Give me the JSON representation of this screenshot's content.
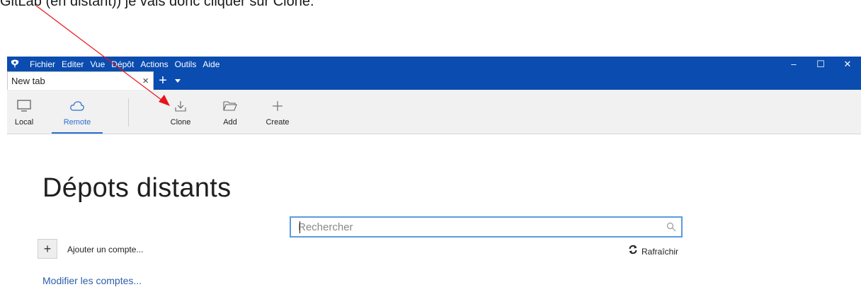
{
  "caption": "GitLab (en distant)) je vais donc cliquer sur Clone.",
  "menu": [
    "Fichier",
    "Editer",
    "Vue",
    "Dépôt",
    "Actions",
    "Outils",
    "Aide"
  ],
  "window_controls": {
    "minimize": "–",
    "maximize": "☐",
    "close": "✕"
  },
  "tab": {
    "label": "New tab",
    "close": "×",
    "add": "+"
  },
  "toolbar": {
    "local": "Local",
    "remote": "Remote",
    "clone": "Clone",
    "add": "Add",
    "create": "Create"
  },
  "main": {
    "title": "Dépots distants",
    "search_placeholder": "Rechercher",
    "add_button": "+",
    "add_account": "Ajouter un compte...",
    "refresh": "Rafraîchir",
    "modify_accounts": "Modifier les comptes..."
  },
  "colors": {
    "titlebar": "#0a4cb0",
    "accent": "#2c6fd1",
    "annotation_arrow": "#e8141b"
  }
}
